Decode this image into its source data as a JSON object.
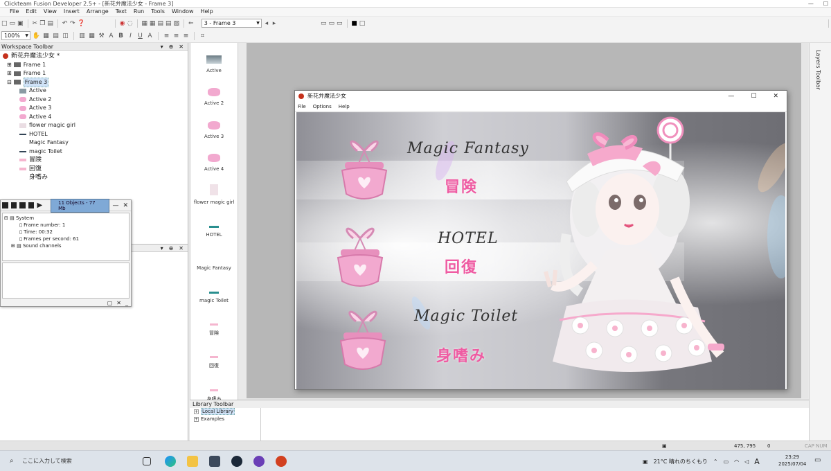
{
  "app": {
    "title": "Clickteam Fusion Developer 2.5+ - [新花弁魔法少女 - Frame 3]",
    "window_buttons": [
      "—",
      "☐"
    ]
  },
  "menu": [
    "File",
    "Edit",
    "View",
    "Insert",
    "Arrange",
    "Text",
    "Run",
    "Tools",
    "Window",
    "Help"
  ],
  "toolbar": {
    "zoom": "100%",
    "frame_select": "3 - Frame 3",
    "bold": "B",
    "italic": "I",
    "underline": "U"
  },
  "workspace": {
    "title": "Workspace Toolbar",
    "app_node": "新花弁魔法少女 *",
    "frames": [
      "Frame 1",
      "Frame 1",
      "Frame 3"
    ],
    "objects": [
      "Active",
      "Active 2",
      "Active 3",
      "Active 4",
      "flower magic girl",
      "HOTEL",
      "Magic Fantasy",
      "magic Toilet",
      "冒険",
      "回復",
      "身嗜み"
    ]
  },
  "debugger": {
    "object_count": "11 Objects - 77 Mb",
    "rows": [
      "System",
      "Frame number: 1",
      "Time: 00:32",
      "Frames per second: 61",
      "Sound channels"
    ]
  },
  "objstrip": [
    "Active",
    "Active 2",
    "Active 3",
    "Active 4",
    "flower magic girl",
    "HOTEL",
    "Magic Fantasy",
    "magic Toilet",
    "冒険",
    "回復",
    "身嗜み"
  ],
  "game": {
    "title": "新花弁魔法少女",
    "menu": [
      "File",
      "Options",
      "Help"
    ],
    "buttons_en": [
      "Magic Fantasy",
      "HOTEL",
      "Magic Toilet"
    ],
    "buttons_jp": [
      "冒険",
      "回復",
      "身嗜み"
    ],
    "colors": {
      "pink": "#ef5ba2",
      "basket": "#f2a9cf"
    }
  },
  "layers": {
    "title": "Layers Toolbar"
  },
  "library": {
    "title": "Library Toolbar",
    "items": [
      "Local Library",
      "Examples"
    ]
  },
  "status": {
    "coords": "475, 795",
    "zero": "0",
    "caps": "CAP NUM"
  },
  "taskbar": {
    "search_placeholder": "ここに入力して検索",
    "weather": "21°C  晴れのちくもり",
    "ime": "A",
    "time": "23:29",
    "date": "2025/07/04"
  }
}
